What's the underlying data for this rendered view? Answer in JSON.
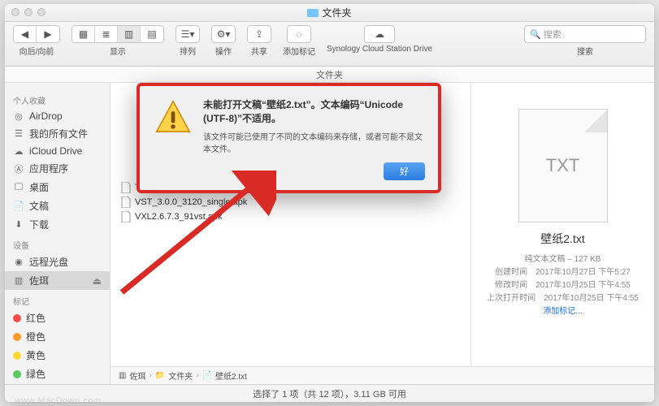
{
  "window": {
    "title": "文件夹"
  },
  "toolbar": {
    "nav_label": "向后/向前",
    "view_label": "显示",
    "arrange_label": "排列",
    "action_label": "操作",
    "share_label": "共享",
    "tag_label": "添加标记",
    "cloud_label": "Synology Cloud Station Drive",
    "search_label": "搜索",
    "search_placeholder": "搜索"
  },
  "pathheader": "文件夹",
  "sidebar": {
    "h_fav": "个人收藏",
    "fav": [
      {
        "icon": "airdrop-icon",
        "label": "AirDrop"
      },
      {
        "icon": "allfiles-icon",
        "label": "我的所有文件"
      },
      {
        "icon": "icloud-icon",
        "label": "iCloud Drive"
      },
      {
        "icon": "apps-icon",
        "label": "应用程序"
      },
      {
        "icon": "desktop-icon",
        "label": "桌面"
      },
      {
        "icon": "docs-icon",
        "label": "文稿"
      },
      {
        "icon": "downloads-icon",
        "label": "下载"
      }
    ],
    "h_dev": "设备",
    "dev": [
      {
        "icon": "remote-icon",
        "label": "远程光盘"
      },
      {
        "icon": "disk-icon",
        "label": "佐珥",
        "selected": true
      }
    ],
    "h_tag": "标记",
    "tags": [
      {
        "color": "#ff4d4d",
        "label": "红色"
      },
      {
        "color": "#ff9b2a",
        "label": "橙色"
      },
      {
        "color": "#ffd633",
        "label": "黄色"
      },
      {
        "color": "#5ac85a",
        "label": "绿色"
      }
    ]
  },
  "files": [
    {
      "name": "TaijiTV.pc6.apk"
    },
    {
      "name": "VST_3.0.0_3120_single.apk"
    },
    {
      "name": "VXL2.6.7.3_91vst.apk"
    }
  ],
  "preview": {
    "thumb_label": "TXT",
    "name": "壁纸2.txt",
    "kind": "纯文本文稿 – 127 KB",
    "created_lbl": "创建时间",
    "created_val": "2017年10月27日 下午5:27",
    "modified_lbl": "修改时间",
    "modified_val": "2017年10月25日 下午4:55",
    "opened_lbl": "上次打开时间",
    "opened_val": "2017年10月25日 下午4:55",
    "addtag": "添加标记..."
  },
  "breadcrumb": {
    "a": "佐珥",
    "b": "文件夹",
    "c": "壁纸2.txt"
  },
  "statusbar": "选择了 1 项（共 12 项），3.11 GB 可用",
  "dialog": {
    "title": "未能打开文稿“壁纸2.txt”。文本编码“Unicode (UTF-8)”不适用。",
    "desc": "该文件可能已使用了不同的文本编码来存储，或者可能不是文本文件。",
    "ok": "好"
  },
  "watermark": "www.MacDown.com"
}
